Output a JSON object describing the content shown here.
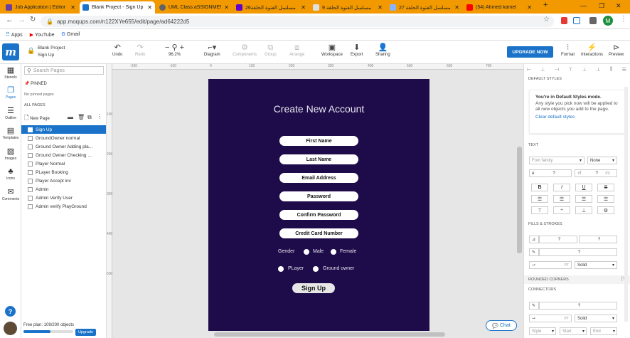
{
  "browser": {
    "tabs": [
      {
        "label": "Job Application | Editor",
        "color": "#6b3fa0"
      },
      {
        "label": "Blank Project - Sign Up",
        "color": "#1a73c9"
      },
      {
        "label": "UML Class aSSIGNMENT",
        "color": "#5f6368"
      },
      {
        "label": "مسلسل الفتوة الحلقة26",
        "color": "#6001d2"
      },
      {
        "label": "مسلسل الفتوة الحلقة 9",
        "color": "#e0e0e0"
      },
      {
        "label": "مسلسل الفتوة الحلقة 27",
        "color": "#8ab4f8"
      },
      {
        "label": "(54) Ahmed kamel",
        "color": "#ff0000"
      }
    ],
    "url": "app.moqups.com/n122XYe655/edit/page/ad64222d5",
    "bookmarks": [
      "Apps",
      "YouTube",
      "Gmail"
    ],
    "profile": "M"
  },
  "app": {
    "project": "Blank Project",
    "page": "Sign Up",
    "toolbar": {
      "undo": "Undo",
      "redo": "Redo",
      "zoom": "96.2%",
      "diagram": "Diagram",
      "components": "Components",
      "group": "Group",
      "arrange": "Arrange",
      "workspace": "Workspace",
      "export": "Export",
      "sharing": "Sharing",
      "upgrade": "UPGRADE NOW",
      "format": "Format",
      "interactions": "Interactions",
      "preview": "Preview"
    },
    "rail": [
      "Stencils",
      "Pages",
      "Outline",
      "Templates",
      "Images",
      "Icons",
      "Comments"
    ]
  },
  "pages_panel": {
    "search_placeholder": "Search Pages",
    "pinned_label": "PINNED",
    "no_pinned": "No pinned pages",
    "all_pages": "ALL PAGES",
    "new_page": "New Page",
    "items": [
      "Sign Up",
      "GroundOwner normal",
      "Ground Owner Adding pla...",
      "Ground Owner Checking ...",
      "Player Normal",
      "PLayer Booking",
      "Player Accept inv",
      "Admin",
      "Admin Verify User",
      "Admin verify PlayGround"
    ],
    "selected": 0,
    "plan": "Free plan: 109/200 objects",
    "plan_progress": 0.545,
    "upgrade": "Upgrade"
  },
  "canvas": {
    "ruler_top": [
      "-200",
      "-100",
      "0",
      "100",
      "200",
      "300",
      "400",
      "500",
      "600",
      "700"
    ],
    "ruler_left": [
      "100",
      "200",
      "300",
      "400",
      "500"
    ],
    "form": {
      "title": "Create New Account",
      "fields": [
        "First Name",
        "Last Name",
        "Email Address",
        "Password",
        "Confirm Password",
        "Credit Card Number"
      ],
      "gender_label": "Gender",
      "male": "Male",
      "female": "Female",
      "player": "PLayer",
      "ground_owner": "Ground owner",
      "submit": "Sign Up",
      "bg_color": "#1e0b4a"
    },
    "chat": "Chat"
  },
  "right_panel": {
    "default_styles": "DEFAULT STYLES",
    "info_title": "You're in Default Styles mode.",
    "info_body": "Any style you pick now will be applied to all new objects you add to the page.",
    "clear_link": "Clear default styles",
    "text_section": "TEXT",
    "font_family": "Font family",
    "font_none": "None",
    "font_size": "?",
    "line_height": "?",
    "pt": "PX",
    "fills": "FILLS & STROKES",
    "fill1": "?",
    "fill2": "?",
    "stroke": "?",
    "stroke_pt": "PT",
    "stroke_style": "Solid",
    "rounded": "ROUNDED CORNERS",
    "connectors": "CONNECTORS",
    "conn_value": "?",
    "conn_pt": "PT",
    "conn_style": "Solid",
    "conn_end1": "Style",
    "conn_end2": "Start",
    "conn_end3": "End"
  }
}
